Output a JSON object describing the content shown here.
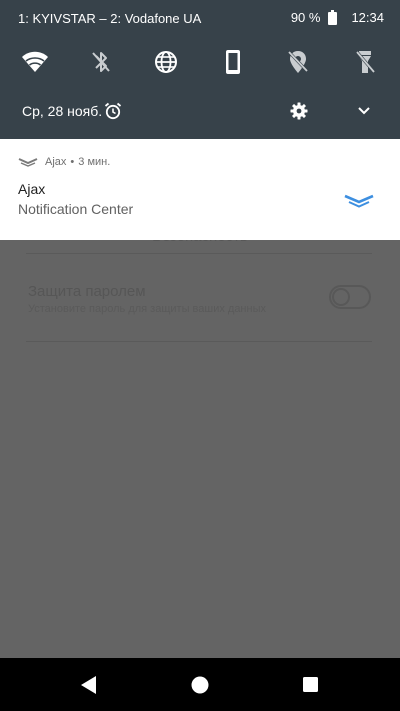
{
  "status_bar": {
    "carrier": "1: KYIVSTAR – 2: Vodafone UA",
    "battery_percent": "90 %",
    "time": "12:34"
  },
  "quick_settings": [
    {
      "name": "wifi-icon",
      "active": true
    },
    {
      "name": "bluetooth-off-icon",
      "active": false
    },
    {
      "name": "globe-icon",
      "active": true
    },
    {
      "name": "phone-rotation-icon",
      "active": true
    },
    {
      "name": "location-off-icon",
      "active": false
    },
    {
      "name": "flashlight-off-icon",
      "active": false
    }
  ],
  "shade": {
    "date": "Ср, 28 нояб."
  },
  "notification": {
    "app_name": "Ajax",
    "separator": "•",
    "time_ago": "3 мин.",
    "title": "Ajax",
    "text": "Notification Center"
  },
  "background_app": {
    "section_title": "Безопасность",
    "setting_title": "Защита паролем",
    "setting_subtitle": "Установите пароль для защиты ваших данных",
    "setting_enabled": false
  },
  "colors": {
    "shade_bg": "#37424a",
    "scrim": "#646464",
    "ajax_blue": "#3d8fe0",
    "nav_bar": "#000000"
  }
}
